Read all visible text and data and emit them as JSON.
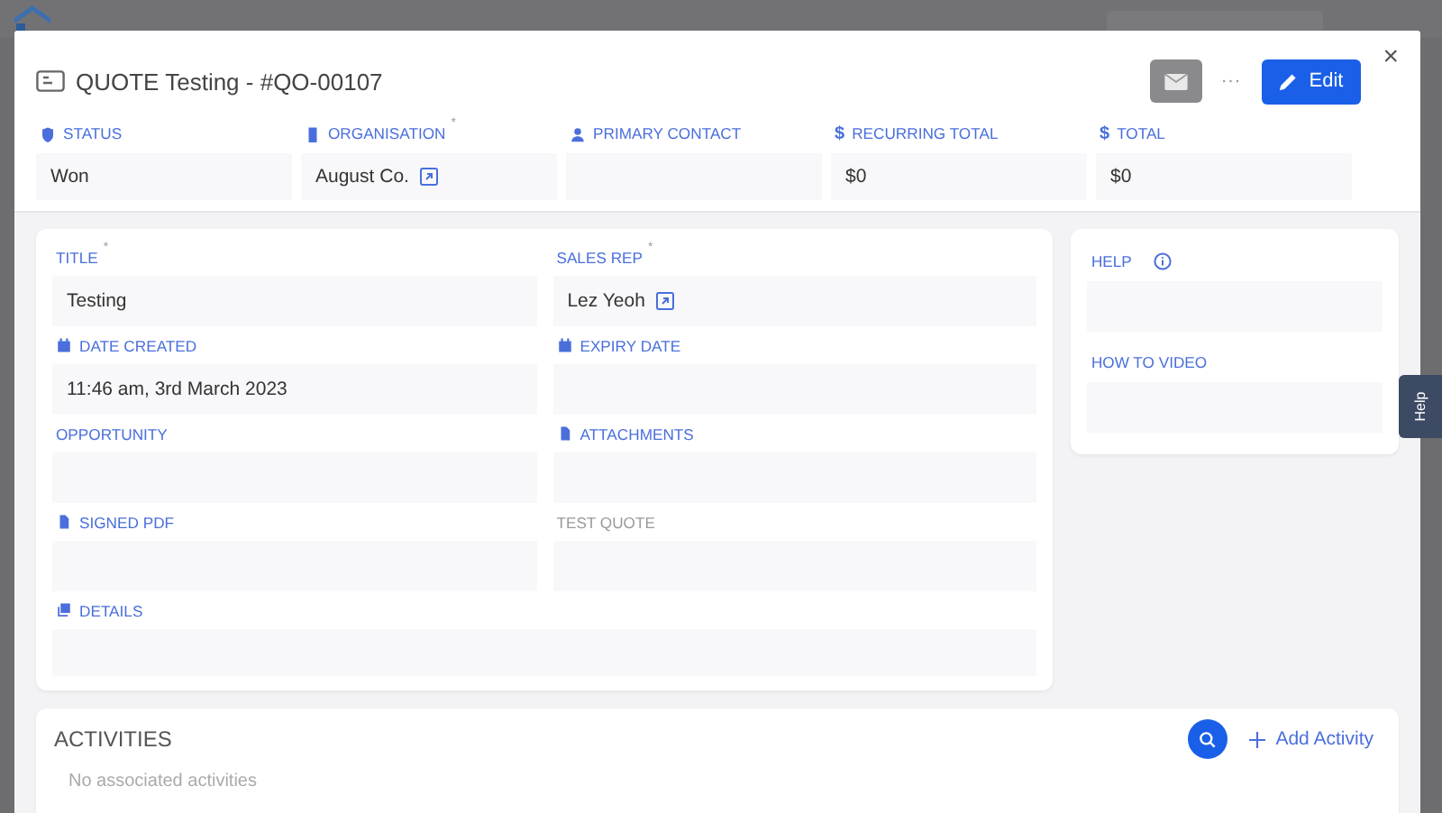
{
  "modal": {
    "title": "QUOTE Testing - #QO-00107",
    "actions": {
      "more": "···",
      "edit": "Edit",
      "close": "×"
    },
    "summary_fields": [
      {
        "label": "STATUS",
        "value": "Won",
        "link": false
      },
      {
        "label": "ORGANISATION",
        "required_mark": "*",
        "value": "August Co.",
        "link": true
      },
      {
        "label": "PRIMARY CONTACT",
        "link": false
      },
      {
        "label": "RECURRING TOTAL",
        "symbol": "$",
        "value": "$0",
        "link": false
      },
      {
        "label": "TOTAL",
        "symbol": "$",
        "value": "$0",
        "link": false
      }
    ],
    "fields": [
      {
        "label": "TITLE",
        "required_mark": "*",
        "muted": false,
        "value": "Testing",
        "link": false
      },
      {
        "label": "SALES REP",
        "required_mark": "*",
        "muted": false,
        "value": "Lez Yeoh",
        "link": true
      },
      {
        "label": "DATE CREATED",
        "muted": false,
        "value": "11:46 am, 3rd March 2023",
        "link": false
      },
      {
        "label": "EXPIRY DATE",
        "muted": false,
        "link": false
      },
      {
        "label": "OPPORTUNITY",
        "muted": false,
        "link": false
      },
      {
        "label": "ATTACHMENTS",
        "muted": false,
        "link": false
      },
      {
        "label": "SIGNED PDF",
        "muted": false,
        "link": false
      },
      {
        "label": "TEST QUOTE",
        "muted": true,
        "link": false
      }
    ],
    "details": {
      "label": "DETAILS"
    },
    "help": {
      "label": "HELP",
      "video_label": "HOW TO VIDEO"
    },
    "activities": {
      "title": "ACTIVITIES",
      "add": "Add Activity",
      "empty": "No associated activities"
    }
  },
  "help_tab": "Help"
}
